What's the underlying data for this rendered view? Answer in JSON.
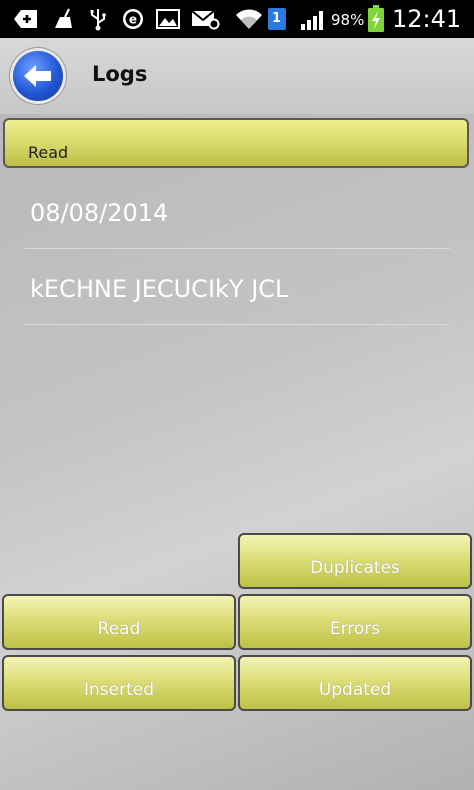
{
  "status_bar": {
    "battery": "98%",
    "time": "12:41",
    "sim_badge": "1"
  },
  "action_bar": {
    "title": "Logs"
  },
  "tab_header": {
    "label": "Read"
  },
  "logs": [
    {
      "text": "08/08/2014"
    },
    {
      "text": "kECHNE JECUCIkY JCL"
    }
  ],
  "buttons": {
    "duplicates": "Duplicates",
    "read": "Read",
    "errors": "Errors",
    "inserted": "Inserted",
    "updated": "Updated"
  },
  "colors": {
    "button_yellow": "#d6d768",
    "back_blue": "#2257d6"
  }
}
